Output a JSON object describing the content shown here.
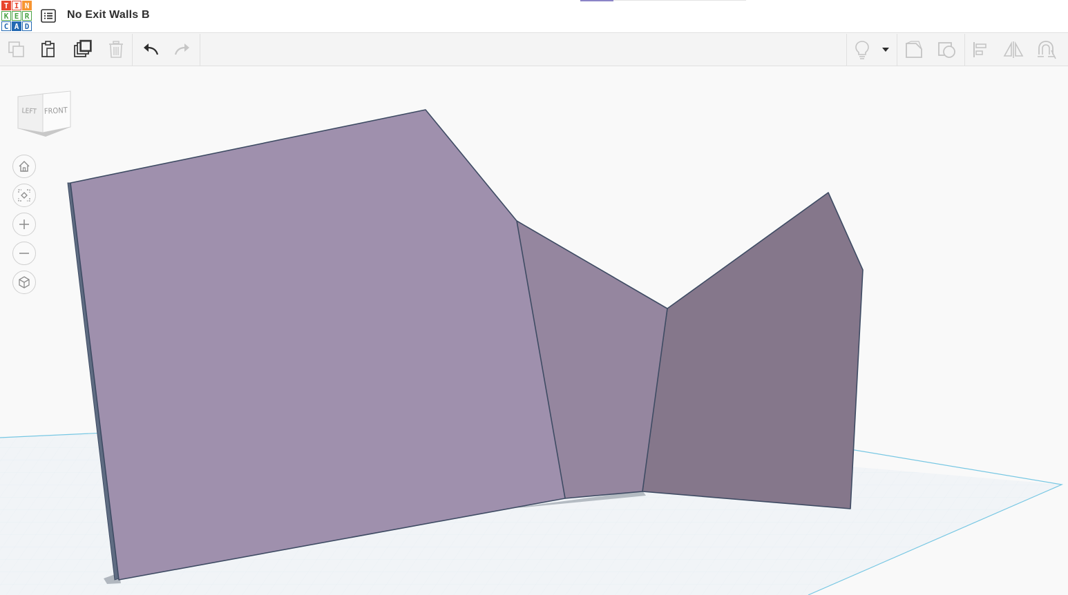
{
  "app": {
    "logo_letters": [
      "T",
      "I",
      "N",
      "K",
      "E",
      "R",
      "C",
      "A",
      "D"
    ],
    "document_title": "No Exit Walls B"
  },
  "toolbar": {
    "left_tools": [
      {
        "name": "copy-icon",
        "enabled": false
      },
      {
        "name": "paste-icon",
        "enabled": true
      },
      {
        "name": "duplicate-icon",
        "enabled": true
      },
      {
        "name": "delete-icon",
        "enabled": false
      },
      {
        "name": "undo-icon",
        "enabled": true
      },
      {
        "name": "redo-icon",
        "enabled": false
      }
    ],
    "right_tools": [
      {
        "name": "lightbulb-icon"
      },
      {
        "name": "dropdown-caret-icon"
      },
      {
        "name": "group-icon"
      },
      {
        "name": "ungroup-icon"
      },
      {
        "name": "align-icon"
      },
      {
        "name": "mirror-icon"
      },
      {
        "name": "magnet-icon"
      }
    ]
  },
  "viewcube": {
    "left_label": "LEFT",
    "front_label": "FRONT"
  },
  "nav_controls": [
    {
      "name": "home-view-icon"
    },
    {
      "name": "fit-view-icon"
    },
    {
      "name": "zoom-in-icon"
    },
    {
      "name": "zoom-out-icon"
    },
    {
      "name": "ortho-perspective-icon"
    }
  ],
  "colors": {
    "accent": "#8b84c7",
    "wall_front": "#9f90ad",
    "wall_middle": "#95869f",
    "wall_right": "#85778b",
    "wall_edge": "#3e4b63",
    "workplane_line": "#77c7e3"
  }
}
